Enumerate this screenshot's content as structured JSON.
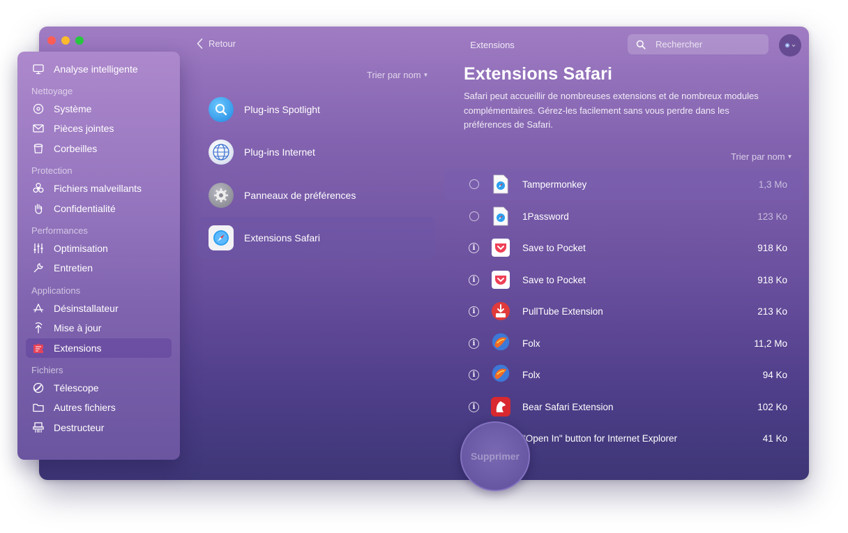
{
  "window": {
    "title": "Extensions"
  },
  "toolbar": {
    "back_label": "Retour",
    "search_placeholder": "Rechercher"
  },
  "sidebar": {
    "top_item": {
      "label": "Analyse intelligente",
      "icon": "monitor-icon"
    },
    "sections": [
      {
        "title": "Nettoyage",
        "items": [
          {
            "label": "Système",
            "icon": "disc-icon"
          },
          {
            "label": "Pièces jointes",
            "icon": "envelope-icon"
          },
          {
            "label": "Corbeilles",
            "icon": "trash-icon"
          }
        ]
      },
      {
        "title": "Protection",
        "items": [
          {
            "label": "Fichiers malveillants",
            "icon": "biohazard-icon"
          },
          {
            "label": "Confidentialité",
            "icon": "hand-icon"
          }
        ]
      },
      {
        "title": "Performances",
        "items": [
          {
            "label": "Optimisation",
            "icon": "sliders-icon"
          },
          {
            "label": "Entretien",
            "icon": "wrench-icon"
          }
        ]
      },
      {
        "title": "Applications",
        "items": [
          {
            "label": "Désinstallateur",
            "icon": "app-store-icon"
          },
          {
            "label": "Mise à jour",
            "icon": "update-icon"
          },
          {
            "label": "Extensions",
            "icon": "puzzle-icon",
            "active": true
          }
        ]
      },
      {
        "title": "Fichiers",
        "items": [
          {
            "label": "Télescope",
            "icon": "lens-icon"
          },
          {
            "label": "Autres fichiers",
            "icon": "folder-icon"
          },
          {
            "label": "Destructeur",
            "icon": "shredder-icon"
          }
        ]
      }
    ]
  },
  "categories": {
    "sort_label": "Trier par nom",
    "items": [
      {
        "label": "Plug-ins Spotlight",
        "icon": "spotlight-icon"
      },
      {
        "label": "Plug-ins Internet",
        "icon": "globe-icon"
      },
      {
        "label": "Panneaux de préférences",
        "icon": "gear-icon"
      },
      {
        "label": "Extensions Safari",
        "icon": "safari-icon",
        "active": true
      }
    ]
  },
  "detail": {
    "title": "Extensions Safari",
    "description": "Safari peut accueillir de nombreuses extensions et de nombreux modules complémentaires. Gérez-les facilement sans vous perdre dans les préférences de Safari.",
    "sort_label": "Trier par nom",
    "rows": [
      {
        "name": "Tampermonkey",
        "size": "1,3 Mo",
        "control": "checkbox",
        "icon": "safari-doc-icon",
        "selected": true
      },
      {
        "name": "1Password",
        "size": "123 Ko",
        "control": "checkbox",
        "icon": "safari-doc-icon"
      },
      {
        "name": "Save to Pocket",
        "size": "918 Ko",
        "control": "info",
        "icon": "pocket-icon"
      },
      {
        "name": "Save to Pocket",
        "size": "918 Ko",
        "control": "info",
        "icon": "pocket-icon"
      },
      {
        "name": "PullTube Extension",
        "size": "213 Ko",
        "control": "info",
        "icon": "pulltube-icon"
      },
      {
        "name": "Folx",
        "size": "11,2 Mo",
        "control": "info",
        "icon": "folx-icon"
      },
      {
        "name": "Folx",
        "size": "94 Ko",
        "control": "info",
        "icon": "folx-icon"
      },
      {
        "name": "Bear Safari Extension",
        "size": "102 Ko",
        "control": "info",
        "icon": "bear-icon"
      },
      {
        "name": "\"Open In\" button for Internet Explorer",
        "size": "41 Ko",
        "control": "info",
        "icon": "ie-icon"
      }
    ],
    "remove_label": "Supprimer"
  }
}
